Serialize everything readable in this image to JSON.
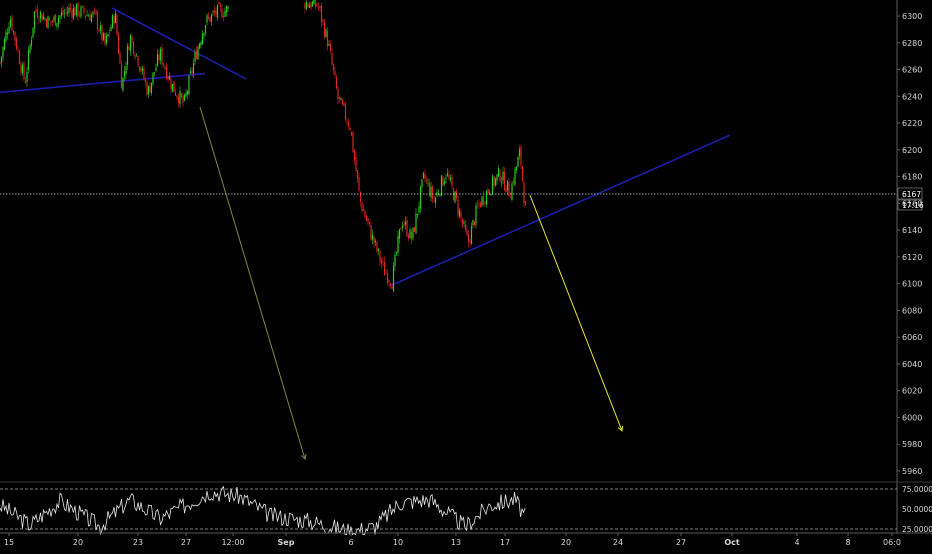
{
  "theme": {
    "background": "#000000",
    "axis_line": "#5a5a5a",
    "axis_text": "#d4d4d4",
    "bull_candle": "#2ecc1f",
    "bear_candle": "#e0241e",
    "trendline": "#1c1caa",
    "projection_arrow_1": "#7c8a40",
    "projection_arrow_2": "#e6e62e",
    "price_line": "#cfcfcf",
    "oscillator_line": "#e6e6e6",
    "oscillator_levels": "#bfbfbf"
  },
  "chart_data": {
    "type": "candlestick",
    "instrument": "",
    "grid": false,
    "price_axis": {
      "range": [
        5950,
        6310
      ],
      "ticks": [
        6300,
        6280,
        6260,
        6240,
        6220,
        6200,
        6180,
        6160,
        6140,
        6120,
        6100,
        6080,
        6060,
        6040,
        6020,
        6000,
        5980,
        5960
      ],
      "position": "right"
    },
    "time_axis": {
      "labels": [
        "15",
        "20",
        "23",
        "27",
        "12:00",
        "Sep",
        "6",
        "10",
        "13",
        "17",
        "20",
        "24",
        "27",
        "Oct",
        "4",
        "8",
        "06:0"
      ],
      "position": "bottom"
    },
    "last_price": {
      "value": 6167,
      "label": "6167",
      "timer": "17:16"
    },
    "price_path": [
      {
        "t": 0,
        "p": 6265
      },
      {
        "t": 10,
        "p": 6300
      },
      {
        "t": 25,
        "p": 6250
      },
      {
        "t": 35,
        "p": 6305
      },
      {
        "t": 50,
        "p": 6295
      },
      {
        "t": 70,
        "p": 6305
      },
      {
        "t": 95,
        "p": 6300
      },
      {
        "t": 105,
        "p": 6278
      },
      {
        "t": 115,
        "p": 6302
      },
      {
        "t": 122,
        "p": 6248
      },
      {
        "t": 130,
        "p": 6285
      },
      {
        "t": 138,
        "p": 6268
      },
      {
        "t": 148,
        "p": 6243
      },
      {
        "t": 160,
        "p": 6272
      },
      {
        "t": 172,
        "p": 6248
      },
      {
        "t": 184,
        "p": 6234
      },
      {
        "t": 196,
        "p": 6272
      },
      {
        "t": 205,
        "p": 6295
      },
      {
        "t": 215,
        "p": 6302
      },
      {
        "t": 228,
        "p": 6305
      },
      {
        "t": 232,
        "p": null
      },
      {
        "t": 300,
        "p": null
      },
      {
        "t": 305,
        "p": 6310
      },
      {
        "t": 318,
        "p": 6308
      },
      {
        "t": 328,
        "p": 6280
      },
      {
        "t": 338,
        "p": 6238
      },
      {
        "t": 350,
        "p": 6218
      },
      {
        "t": 360,
        "p": 6162
      },
      {
        "t": 372,
        "p": 6135
      },
      {
        "t": 384,
        "p": 6110
      },
      {
        "t": 392,
        "p": 6102
      },
      {
        "t": 402,
        "p": 6148
      },
      {
        "t": 412,
        "p": 6133
      },
      {
        "t": 424,
        "p": 6180
      },
      {
        "t": 434,
        "p": 6162
      },
      {
        "t": 446,
        "p": 6183
      },
      {
        "t": 456,
        "p": 6162
      },
      {
        "t": 468,
        "p": 6130
      },
      {
        "t": 478,
        "p": 6158
      },
      {
        "t": 490,
        "p": 6172
      },
      {
        "t": 500,
        "p": 6182
      },
      {
        "t": 510,
        "p": 6168
      },
      {
        "t": 520,
        "p": 6198
      },
      {
        "t": 526,
        "p": 6150
      }
    ],
    "trendlines": [
      {
        "from": {
          "t": 0,
          "p": 6243
        },
        "to": {
          "t": 205,
          "p": 6257
        }
      },
      {
        "from": {
          "t": 112,
          "p": 6306
        },
        "to": {
          "t": 246,
          "p": 6253
        }
      },
      {
        "from": {
          "t": 392,
          "p": 6099
        },
        "to": {
          "t": 730,
          "p": 6211
        }
      }
    ],
    "projection_arrows": [
      {
        "from": {
          "t": 200,
          "p": 6232
        },
        "to": {
          "t": 305,
          "p": 5969
        }
      },
      {
        "from": {
          "t": 530,
          "p": 6166
        },
        "to": {
          "t": 622,
          "p": 5990
        }
      }
    ],
    "oscillator": {
      "levels": [
        75,
        50,
        25
      ],
      "level_labels": [
        "75.0000",
        "50.0000",
        "25.0000"
      ],
      "range": [
        15,
        80
      ],
      "path": [
        {
          "t": 0,
          "v": 55
        },
        {
          "t": 30,
          "v": 30
        },
        {
          "t": 60,
          "v": 60
        },
        {
          "t": 100,
          "v": 28
        },
        {
          "t": 130,
          "v": 62
        },
        {
          "t": 160,
          "v": 38
        },
        {
          "t": 210,
          "v": 72
        },
        {
          "t": 240,
          "v": 66
        },
        {
          "t": 270,
          "v": 42
        },
        {
          "t": 310,
          "v": 35
        },
        {
          "t": 350,
          "v": 22
        },
        {
          "t": 375,
          "v": 28
        },
        {
          "t": 400,
          "v": 58
        },
        {
          "t": 430,
          "v": 62
        },
        {
          "t": 465,
          "v": 28
        },
        {
          "t": 490,
          "v": 55
        },
        {
          "t": 515,
          "v": 62
        },
        {
          "t": 526,
          "v": 38
        }
      ]
    }
  }
}
